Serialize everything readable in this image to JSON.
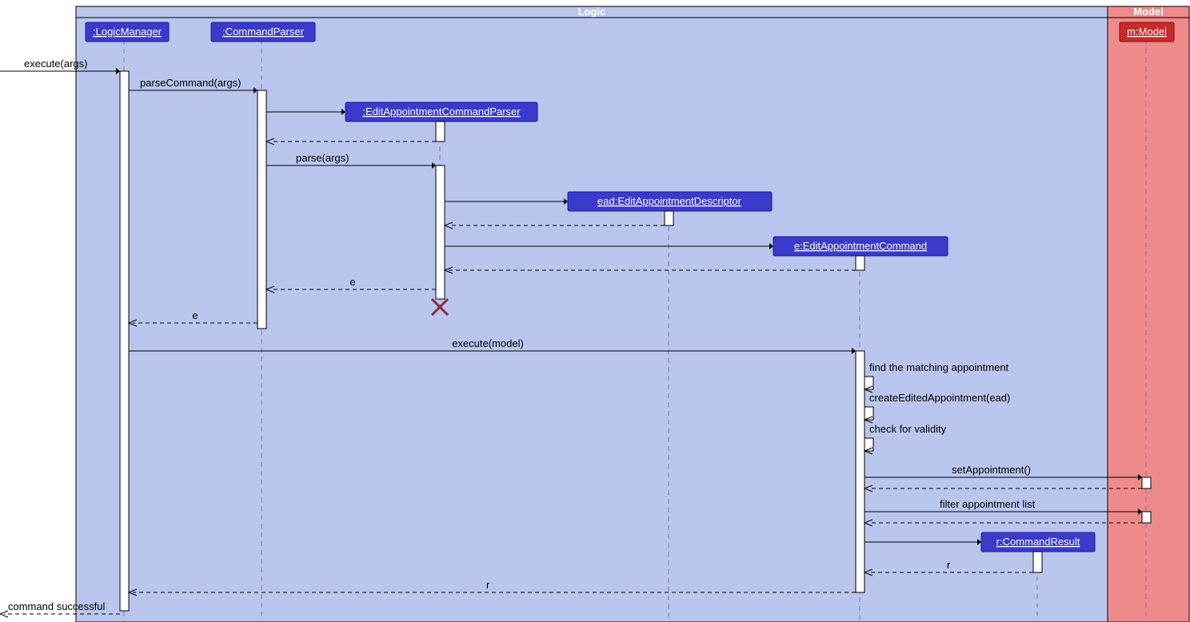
{
  "frames": {
    "logic_title": "Logic",
    "model_title": "Model"
  },
  "participants": {
    "logic_manager": ":LogicManager",
    "command_parser": ":CommandParser",
    "eacp": ":EditAppointmentCommandParser",
    "ead": "ead:EditAppointmentDescriptor",
    "eac": "e:EditAppointmentCommand",
    "command_result": "r:CommandResult",
    "model": "m:Model"
  },
  "messages": {
    "execute_args": "execute(args)",
    "parse_command": "parseCommand(args)",
    "parse_args": "parse(args)",
    "return_e1": "e",
    "return_e2": "e",
    "execute_model": "execute(model)",
    "find_appt": "find the matching appointment",
    "create_edited": "createEditedAppointment(ead)",
    "check_validity": "check for validity",
    "set_appt": "setAppointment()",
    "filter_list": "filter appointment list",
    "return_r1": "r",
    "return_r2": "r",
    "command_successful": "command successful"
  }
}
